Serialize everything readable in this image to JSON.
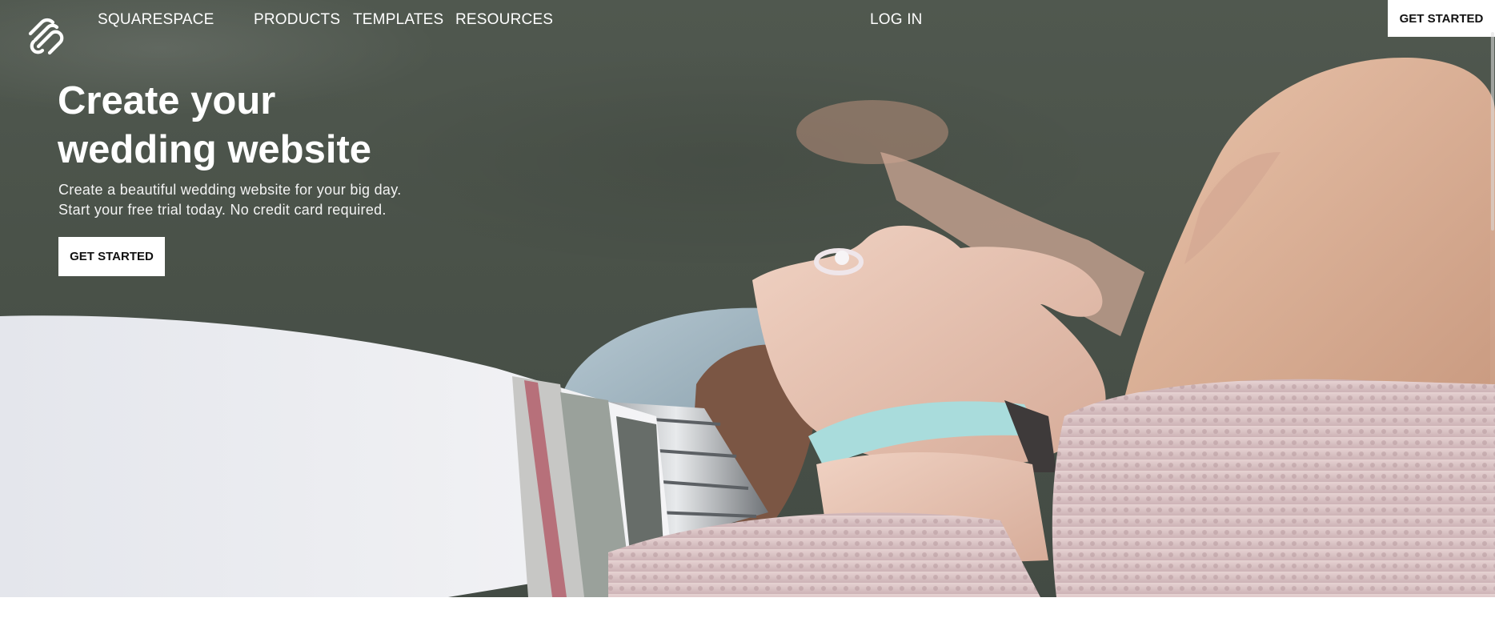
{
  "header": {
    "brand": "SQUARESPACE",
    "nav": {
      "products": "PRODUCTS",
      "templates": "TEMPLATES",
      "resources": "RESOURCES"
    },
    "login": "LOG IN",
    "cta": "GET STARTED"
  },
  "hero": {
    "title_line1": "Create your",
    "title_line2": "wedding website",
    "subtitle_line1": "Create a beautiful wedding website for your big day.",
    "subtitle_line2": "Start your free trial today. No credit card required.",
    "cta": "GET STARTED",
    "background_image": "couple-holding-hands-photo"
  },
  "icons": {
    "logo": "squarespace-logo-icon"
  },
  "colors": {
    "text_on_hero": "#ffffff",
    "button_bg": "#ffffff",
    "button_text": "#111111",
    "hero_bg": "#4a5249"
  }
}
